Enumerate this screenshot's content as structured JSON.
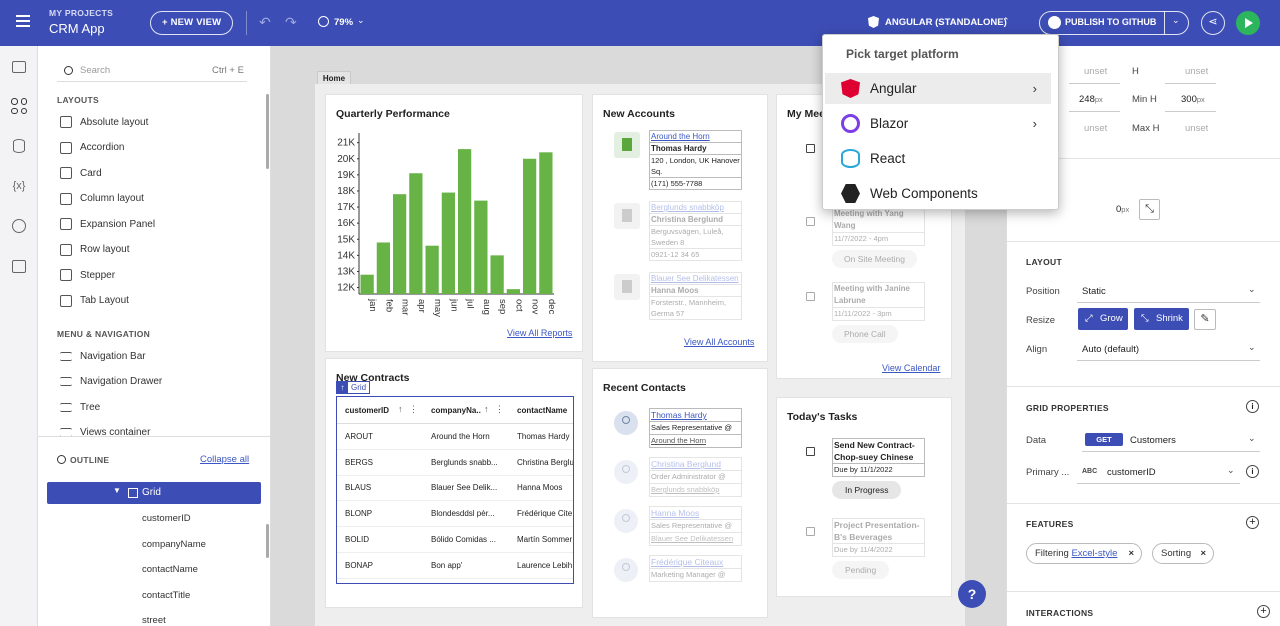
{
  "header": {
    "project_label": "MY PROJECTS",
    "app_name": "CRM App",
    "new_view": "+ NEW VIEW",
    "zoom": "79%",
    "platform": "ANGULAR (STANDALONE)",
    "publish": "PUBLISH TO GITHUB"
  },
  "dropdown": {
    "title": "Pick target platform",
    "items": [
      {
        "label": "Angular",
        "has_submenu": true
      },
      {
        "label": "Blazor",
        "has_submenu": true
      },
      {
        "label": "React",
        "has_submenu": false
      },
      {
        "label": "Web Components",
        "has_submenu": false
      }
    ]
  },
  "left": {
    "search_placeholder": "Search",
    "search_shortcut": "Ctrl + E",
    "layouts_title": "LAYOUTS",
    "layouts": [
      "Absolute layout",
      "Accordion",
      "Card",
      "Column layout",
      "Expansion Panel",
      "Row layout",
      "Stepper",
      "Tab Layout"
    ],
    "menu_title": "MENU & NAVIGATION",
    "menu": [
      "Navigation Bar",
      "Navigation Drawer",
      "Tree",
      "Views container"
    ],
    "outline_title": "OUTLINE",
    "collapse_all": "Collapse all",
    "outline_selected": "Grid",
    "outline_children": [
      "customerID",
      "companyName",
      "contactName",
      "contactTitle",
      "street"
    ]
  },
  "canvas": {
    "home_tab": "Home",
    "quarterly_title": "Quarterly Performance",
    "view_all_reports": "View All Reports",
    "new_accounts_title": "New Accounts",
    "accounts": [
      {
        "company": "Around the Horn",
        "contact": "Thomas Hardy",
        "address": "120 , London, UK Hanover Sq.",
        "phone": "(171) 555-7788"
      },
      {
        "company": "Berglunds snabbköp",
        "contact": "Christina Berglund",
        "address": "Berguvsvägen, Luleå, Sweden 8",
        "phone": "0921-12 34 65"
      },
      {
        "company": "Blauer See Delikatessen",
        "contact": "Hanna Moos",
        "address": "Forsterstr., Mannheim, Germa 57",
        "phone": ""
      }
    ],
    "view_all_accounts": "View All Accounts",
    "meetings_title": "My Meet",
    "meetings": [
      {
        "title": "Meeting with Yang Wang",
        "date": "11/7/2022 - 4pm",
        "tag": "On Site Meeting"
      },
      {
        "title": "Meeting with Janine Labrune",
        "date": "11/11/2022 - 3pm",
        "tag": "Phone Call"
      }
    ],
    "view_calendar": "View Calendar",
    "new_contracts_title": "New Contracts",
    "grid_badge": "Grid",
    "grid_columns": [
      "customerID",
      "companyNa...",
      "contactName"
    ],
    "grid_rows": [
      [
        "AROUT",
        "Around the Horn",
        "Thomas Hardy"
      ],
      [
        "BERGS",
        "Berglunds snabb...",
        "Christina Berglu"
      ],
      [
        "BLAUS",
        "Blauer See Delik...",
        "Hanna Moos"
      ],
      [
        "BLONP",
        "Blondesddsl pèr...",
        "Frédérique Cite"
      ],
      [
        "BOLID",
        "Bólido Comidas ...",
        "Martín Sommer"
      ],
      [
        "BONAP",
        "Bon app'",
        "Laurence Lebih"
      ]
    ],
    "recent_contacts_title": "Recent Contacts",
    "contacts": [
      {
        "name": "Thomas Hardy",
        "title": "Sales Representative @",
        "company": "Around the Horn"
      },
      {
        "name": "Christina Berglund",
        "title": "Order Administrator @",
        "company": "Berglunds snabbköp"
      },
      {
        "name": "Hanna Moos",
        "title": "Sales Representative @",
        "company": "Blauer See Delikatessen"
      },
      {
        "name": "Frédérique Citeaux",
        "title": "Marketing Manager @",
        "company": ""
      }
    ],
    "tasks_title": "Today's Tasks",
    "tasks": [
      {
        "title": "Send New Contract- Chop-suey Chinese",
        "due": "Due by 11/1/2022",
        "tag": "In Progress"
      },
      {
        "title": "Project Presentation- B's Beverages",
        "due": "Due by 11/4/2022",
        "tag": "Pending"
      }
    ],
    "help": "?"
  },
  "chart_data": {
    "type": "bar",
    "categories": [
      "jan",
      "feb",
      "mar",
      "apr",
      "may",
      "jun",
      "jul",
      "aug",
      "sep",
      "oct",
      "nov",
      "dec"
    ],
    "values": [
      12800,
      14800,
      17800,
      19100,
      14600,
      17900,
      20600,
      17400,
      14000,
      11900,
      20000,
      20400
    ],
    "ylim": [
      11600,
      21600
    ],
    "yticks": [
      "12K",
      "13K",
      "14K",
      "15K",
      "16K",
      "17K",
      "18K",
      "19K",
      "20K",
      "21K"
    ],
    "ytick_values": [
      12000,
      13000,
      14000,
      15000,
      16000,
      17000,
      18000,
      19000,
      20000,
      21000
    ],
    "color": "#67b346",
    "grid": false
  },
  "right": {
    "w_unset": "unset",
    "h_label": "H",
    "h_unset": "unset",
    "w_val": "248",
    "px": "px",
    "minh_label": "Min H",
    "minh_val": "300",
    "maxw_unset": "unset",
    "maxh_label": "Max H",
    "maxh_unset": "unset",
    "gap_val": "0",
    "layout_title": "LAYOUT",
    "position_label": "Position",
    "position_val": "Static",
    "resize_label": "Resize",
    "grow": "Grow",
    "shrink": "Shrink",
    "align_label": "Align",
    "align_val": "Auto (default)",
    "grid_props_title": "GRID PROPERTIES",
    "data_label": "Data",
    "get_badge": "GET",
    "data_val": "Customers",
    "primary_label": "Primary ...",
    "abc_badge": "ABC",
    "primary_val": "customerID",
    "features_title": "FEATURES",
    "filtering_label": "Filtering",
    "filtering_val": "Excel-style",
    "sorting_label": "Sorting",
    "interactions_title": "INTERACTIONS"
  }
}
